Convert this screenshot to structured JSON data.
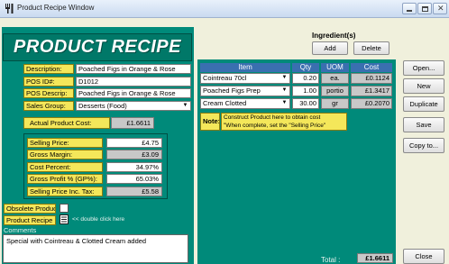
{
  "window": {
    "title": "Product Recipe Window",
    "controls": [
      "minimize",
      "maximize",
      "close"
    ]
  },
  "header": {
    "banner_title": "PRODUCT RECIPE",
    "ingredients_label": "Ingredient(s)",
    "add_label": "Add",
    "delete_label": "Delete"
  },
  "product": {
    "description_label": "Description:",
    "description_value": "Poached Figs in Orange & Rose",
    "pos_id_label": "POS ID#:",
    "pos_id_value": "D1012",
    "pos_descrip_label": "POS Descrip:",
    "pos_descrip_value": "Poached Figs in Orange & Rose",
    "sales_group_label": "Sales Group:",
    "sales_group_value": "Desserts  (Food)",
    "actual_cost_label": "Actual Product Cost:",
    "actual_cost_value": "£1.6611"
  },
  "pricing": {
    "selling_price_label": "Selling Price:",
    "selling_price_value": "£4.75",
    "gross_margin_label": "Gross Margin:",
    "gross_margin_value": "£3.09",
    "cost_percent_label": "Cost Percent:",
    "cost_percent_value": "34.97%",
    "gross_profit_label": "Gross Profit % (GP%):",
    "gross_profit_value": "65.03%",
    "selling_inc_tax_label": "Selling Price Inc. Tax:",
    "selling_inc_tax_value": "£5.58"
  },
  "flags": {
    "obsolete_label": "Obsolete Product",
    "obsolete_checked": false,
    "product_recipe_label": "Product Recipe",
    "double_click_hint": "<< double click here",
    "comments_label": "Comments",
    "comments_value": "Special with Cointreau & Clotted Cream added"
  },
  "table": {
    "headers": [
      "Item",
      "Qty",
      "UOM",
      "Cost"
    ],
    "rows": [
      {
        "item": "Cointreau 70cl",
        "qty": "0.20",
        "uom": "ea.",
        "cost": "£0.1124"
      },
      {
        "item": "Poached Figs Prep",
        "qty": "1.00",
        "uom": "portio",
        "cost": "£1.3417"
      },
      {
        "item": "Cream Clotted",
        "qty": "30.00",
        "uom": "gr",
        "cost": "£0.2070"
      }
    ],
    "note_label": "Note:",
    "note_line1": "Construct Product here to obtain cost",
    "note_line2": "\"When complete, set the \"Selling Price\"",
    "total_label": "Total :",
    "total_value": "£1.6611"
  },
  "sidebar": {
    "open_label": "Open...",
    "new_label": "New",
    "duplicate_label": "Duplicate",
    "save_label": "Save",
    "copy_label": "Copy to...",
    "close_label": "Close"
  },
  "colors": {
    "panel": "#008a7a",
    "label_yellow": "#f4e75a",
    "table_header": "#3a6fb0",
    "background": "#f0f0dc"
  }
}
